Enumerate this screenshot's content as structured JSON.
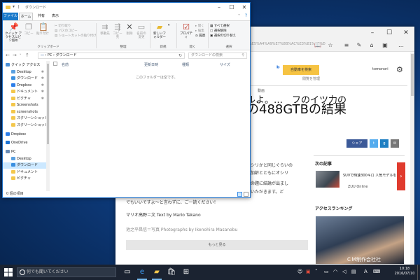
{
  "explorer": {
    "title": "ダウンロード",
    "tabs": [
      "ファイル",
      "ホーム",
      "共有",
      "表示"
    ],
    "ribbon": {
      "pin_quick": "クイック アクセスにピン留め",
      "copy": "コピー",
      "paste": "貼り付け",
      "cut": "切り取り",
      "copy_path": "パスのコピー",
      "paste_shortcut": "ショートカットの貼り付け",
      "move_to": "移動先",
      "copy_to": "コピー先",
      "delete": "削除",
      "rename": "名前の変更",
      "new_folder": "新しいフォルダー",
      "new_item": "新しいアイテム",
      "shortcut": "ショートカット",
      "properties": "プロパティ",
      "open": "開く",
      "edit": "編集",
      "history": "履歴",
      "select_all": "すべて選択",
      "select_none": "選択解除",
      "invert_select": "選択の切り替え",
      "groups": [
        "クリップボード",
        "整理",
        "新規",
        "開く",
        "選択"
      ]
    },
    "path": [
      "PC",
      "ダウンロード"
    ],
    "search_placeholder": "ダウンロードの検索",
    "columns": [
      "名前",
      "更新日時",
      "種類",
      "サイズ"
    ],
    "empty_message": "このフォルダーは空です。",
    "nav_items": [
      {
        "label": "クイック アクセス",
        "pin": false,
        "indent": 0
      },
      {
        "label": "Desktop",
        "pin": true,
        "indent": 1
      },
      {
        "label": "ダウンロード",
        "pin": true,
        "indent": 1
      },
      {
        "label": "Dropbox",
        "pin": true,
        "indent": 1
      },
      {
        "label": "ドキュメント",
        "pin": true,
        "indent": 1
      },
      {
        "label": "ピクチャ",
        "pin": true,
        "indent": 1
      },
      {
        "label": "Screenshots",
        "pin": false,
        "indent": 1
      },
      {
        "label": "screenshots",
        "pin": false,
        "indent": 1
      },
      {
        "label": "スクリーンショット",
        "pin": false,
        "indent": 1
      },
      {
        "label": "スクリーンショット",
        "pin": false,
        "indent": 1
      },
      {
        "label": "Dropbox",
        "pin": false,
        "indent": 0
      },
      {
        "label": "OneDrive",
        "pin": false,
        "indent": 0
      },
      {
        "label": "PC",
        "pin": false,
        "indent": 0
      },
      {
        "label": "Desktop",
        "pin": false,
        "indent": 1
      },
      {
        "label": "ダウンロード",
        "pin": false,
        "indent": 1
      },
      {
        "label": "ドキュメント",
        "pin": false,
        "indent": 1
      },
      {
        "label": "ピクチャ",
        "pin": false,
        "indent": 1
      }
    ],
    "status": "0 個の項目"
  },
  "browser": {
    "url": "%E5%A4%A9%E7%8B%AC%E3%81%AE%E6%99%82%E4%BB%A3%E3%82%92%E3%82%92",
    "search_button": "自動車を検索",
    "favorites_link": "閲覧を管理",
    "user": "tomonori",
    "nav_small": "動画",
    "headline_top": "ルよ。…　フのイツ力の",
    "headline": "の488GTBの結果",
    "share_label": "シェア",
    "article_lines": [
      "オシリかと同じぐらいの",
      "で加齢とともにオシリ",
      "上命題に結論が出まし",
      "ていただきます。ど"
    ],
    "article_tail": "でもいいですよ〜と言わずに、ご一読ください！",
    "credit_text": "マリオ高野＝文 Text by Mario Takano",
    "credit_photo": "池之平昌信＝写真 Photographs by Ikenohira Masanobu",
    "more_button": "もっと見る",
    "next_title": "次の記事",
    "next_item": "SUVで時速300キロ 人気モデルを",
    "next_source": "ZUU Online",
    "ranking_title": "アクセスランキング",
    "ranking_caption": "ＣＭ制作会社社",
    "colors": {
      "facebook": "#3b5998",
      "twitter": "#55acee",
      "search_btn": "#f6c342",
      "accent_red": "#e03b2e"
    }
  },
  "taskbar": {
    "search_placeholder": "何でも聞いてください",
    "time": "10:18",
    "date": "2016/07/10",
    "ime": "A"
  }
}
